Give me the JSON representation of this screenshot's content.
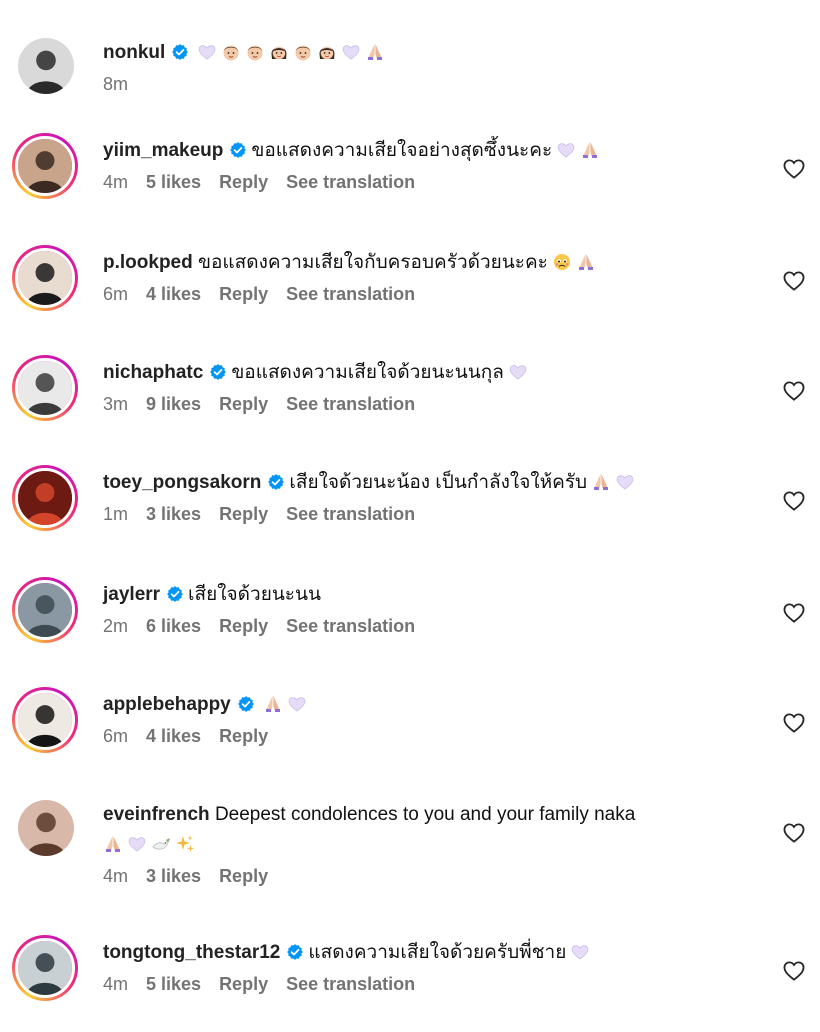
{
  "comments": [
    {
      "user": "nonkul",
      "verified": true,
      "text": "",
      "emojis": [
        "heart-emoji",
        "man-face-emoji",
        "man-face-emoji",
        "woman-face-emoji",
        "man-face-emoji",
        "woman-face-emoji",
        "heart-emoji",
        "pray-emoji"
      ],
      "time": "8m",
      "likes": "",
      "reply": "",
      "translation": "",
      "has_heart": false,
      "story_ring": false
    },
    {
      "user": "yiim_makeup",
      "verified": true,
      "text": "ขอแสดงความเสียใจอย่างสุดซึ้งนะคะ",
      "emojis": [
        "heart-emoji",
        "pray-emoji"
      ],
      "time": "4m",
      "likes": "5 likes",
      "reply": "Reply",
      "translation": "See translation",
      "has_heart": true,
      "story_ring": true
    },
    {
      "user": "p.lookped",
      "verified": false,
      "text": "ขอแสดงความเสียใจกับครอบครัวด้วยนะคะ",
      "emojis": [
        "sad-face-emoji",
        "pray-emoji"
      ],
      "time": "6m",
      "likes": "4 likes",
      "reply": "Reply",
      "translation": "See translation",
      "has_heart": true,
      "story_ring": true
    },
    {
      "user": "nichaphatc",
      "verified": true,
      "text": "ขอแสดงความเสียใจด้วยนะนนกุล",
      "emojis": [
        "heart-emoji"
      ],
      "time": "3m",
      "likes": "9 likes",
      "reply": "Reply",
      "translation": "See translation",
      "has_heart": true,
      "story_ring": true
    },
    {
      "user": "toey_pongsakorn",
      "verified": true,
      "text": "เสียใจด้วยนะน้อง เป็นกำลังใจให้ครับ",
      "emojis": [
        "pray-emoji",
        "heart-emoji"
      ],
      "time": "1m",
      "likes": "3 likes",
      "reply": "Reply",
      "translation": "See translation",
      "has_heart": true,
      "story_ring": true
    },
    {
      "user": "jaylerr",
      "verified": true,
      "text": "เสียใจด้วยนะนน",
      "emojis": [],
      "time": "2m",
      "likes": "6 likes",
      "reply": "Reply",
      "translation": "See translation",
      "has_heart": true,
      "story_ring": true
    },
    {
      "user": "applebehappy",
      "verified": true,
      "text": "",
      "emojis": [
        "pray-emoji",
        "heart-emoji"
      ],
      "time": "6m",
      "likes": "4 likes",
      "reply": "Reply",
      "translation": "",
      "has_heart": true,
      "story_ring": true
    },
    {
      "user": "eveinfrench",
      "verified": false,
      "text": "Deepest condolences to you and your family naka",
      "emojis": [
        "pray-emoji",
        "heart-emoji",
        "dove-emoji",
        "sparkles-emoji"
      ],
      "time": "4m",
      "likes": "3 likes",
      "reply": "Reply",
      "translation": "",
      "has_heart": true,
      "story_ring": false
    },
    {
      "user": "tongtong_thestar12",
      "verified": true,
      "text": "แสดงความเสียใจด้วยครับพี่ชาย",
      "emojis": [
        "heart-emoji"
      ],
      "time": "4m",
      "likes": "5 likes",
      "reply": "Reply",
      "translation": "See translation",
      "has_heart": true,
      "story_ring": true
    }
  ],
  "colors": {
    "verified": "#0095f6",
    "meta": "#737373",
    "heart_emoji": "#e6dcf7"
  }
}
